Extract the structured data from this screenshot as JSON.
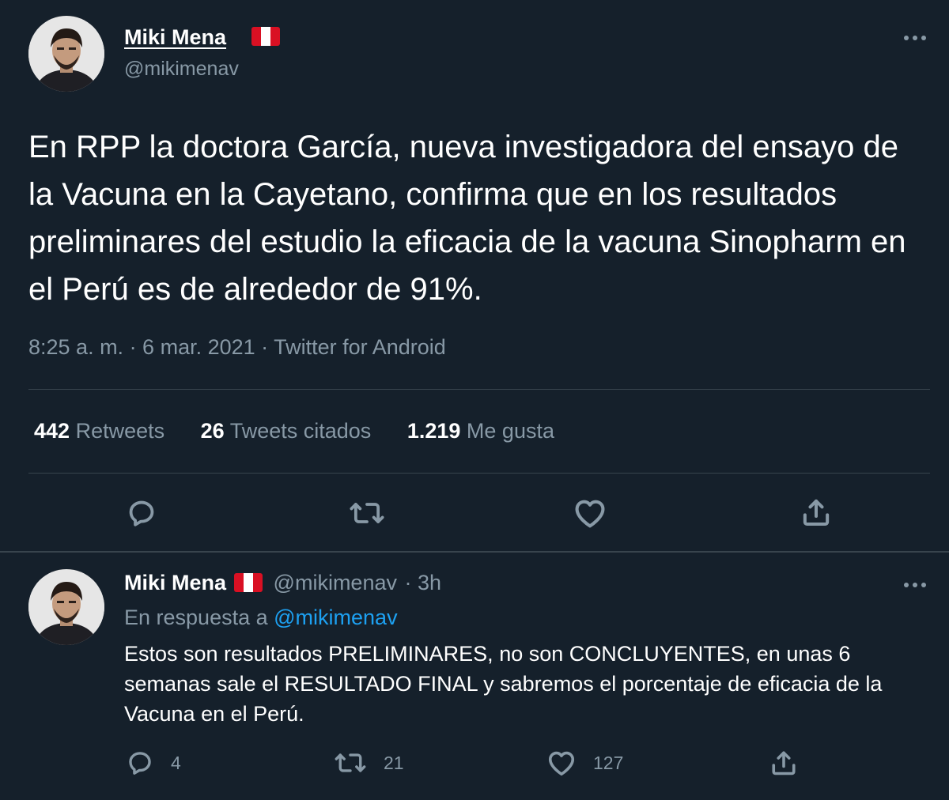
{
  "main_tweet": {
    "author": {
      "name": "Miki Mena",
      "handle": "@mikimenav",
      "flag": "peru-flag"
    },
    "text": "En RPP la doctora García, nueva investigadora del ensayo de la Vacuna en la Cayetano, confirma que en los resultados preliminares del estudio la eficacia de la vacuna Sinopharm en el Perú es de alrededor de 91%.",
    "timestamp": "8:25 a. m. · 6 mar. 2021 · Twitter for Android",
    "stats": {
      "retweets_count": "442",
      "retweets_label": "Retweets",
      "quotes_count": "26",
      "quotes_label": "Tweets citados",
      "likes_count": "1.219",
      "likes_label": "Me gusta"
    },
    "actions": [
      "reply-icon",
      "retweet-icon",
      "like-icon",
      "share-icon"
    ]
  },
  "reply": {
    "author": {
      "name": "Miki Mena",
      "handle": "@mikimenav",
      "time": "· 3h",
      "flag": "peru-flag"
    },
    "in_reply_prefix": "En respuesta a",
    "in_reply_mention": "@mikimenav",
    "text": "Estos son resultados PRELIMINARES, no son CONCLUYENTES, en unas 6 semanas sale el RESULTADO FINAL y sabremos el porcentaje de eficacia de la Vacuna en el Perú.",
    "counts": {
      "replies": "4",
      "retweets": "21",
      "likes": "127"
    }
  },
  "colors": {
    "background": "#15202b",
    "primary_text": "#ffffff",
    "secondary_text": "#8899a6",
    "link": "#1da1f2",
    "divider": "#38444d"
  }
}
